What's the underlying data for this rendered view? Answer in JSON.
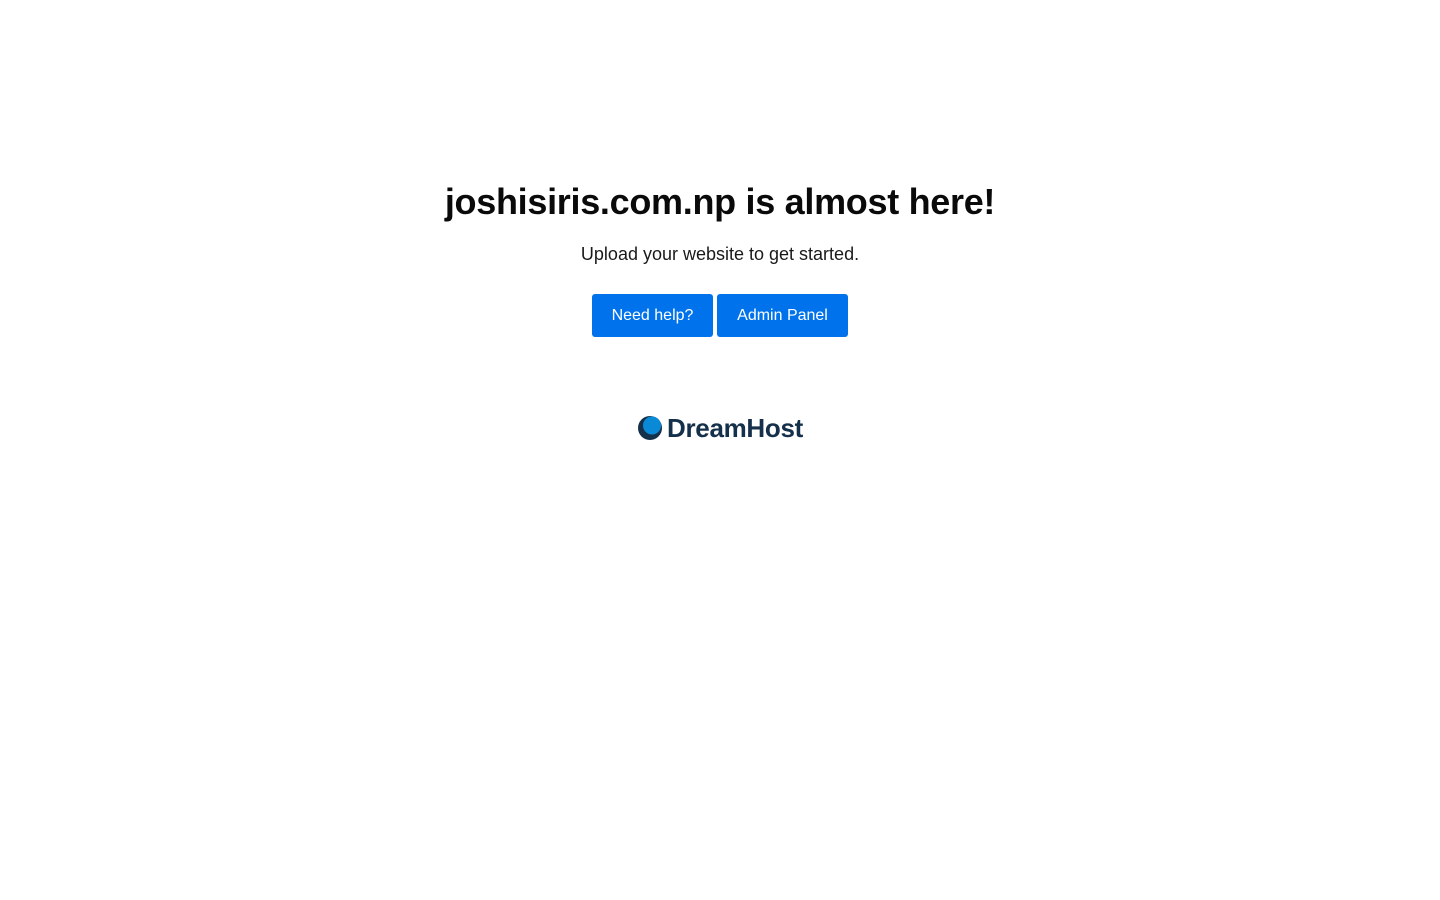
{
  "main": {
    "title": "joshisiris.com.np is almost here!",
    "subtitle": "Upload your website to get started."
  },
  "buttons": {
    "help_label": "Need help?",
    "admin_label": "Admin Panel"
  },
  "brand": {
    "name": "DreamHost",
    "logo_icon": "dreamhost-moon-icon",
    "text_color": "#15304a",
    "mark_color": "#0a8ad6"
  },
  "colors": {
    "accent": "#0073ec",
    "background": "#ffffff"
  }
}
